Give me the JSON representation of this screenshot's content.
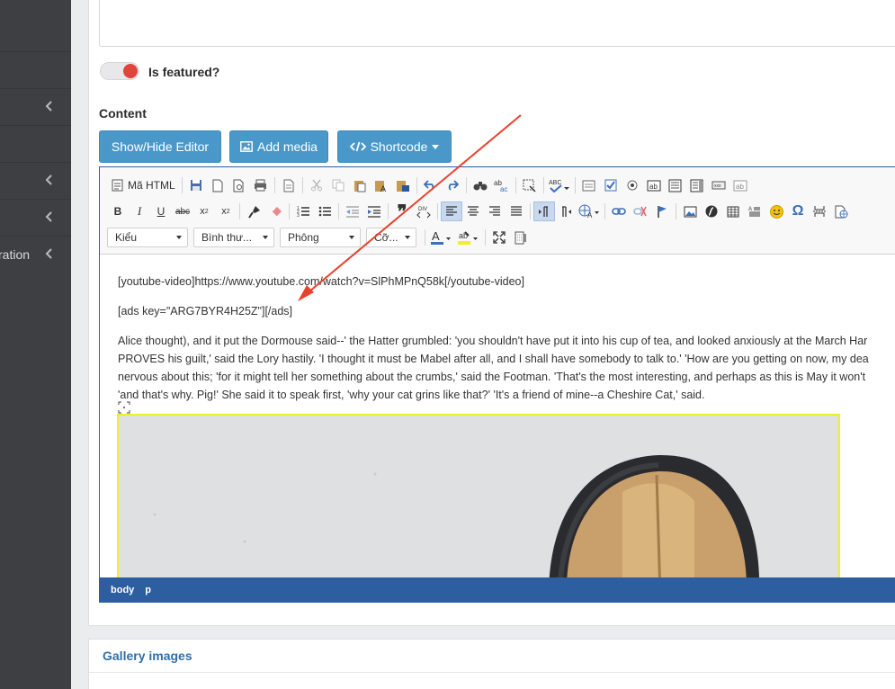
{
  "sidebar": {
    "items": [
      {
        "label": "",
        "has_chevron": false
      },
      {
        "label": "",
        "has_chevron": false
      },
      {
        "label": "",
        "has_chevron": true
      },
      {
        "label": "",
        "has_chevron": false
      },
      {
        "label": "",
        "has_chevron": true
      },
      {
        "label": "",
        "has_chevron": true
      },
      {
        "label": "ration",
        "has_chevron": true
      }
    ]
  },
  "featured": {
    "label": "Is featured?",
    "enabled": true
  },
  "content": {
    "label": "Content"
  },
  "buttons": {
    "show_hide": "Show/Hide Editor",
    "add_media": "Add media",
    "shortcode": "Shortcode"
  },
  "toolbar": {
    "html_label": "Mã HTML",
    "combos": {
      "styles": "Kiểu",
      "format": "Bình thư...",
      "font": "Phông",
      "size": "Cỡ..."
    }
  },
  "editor": {
    "line1": "[youtube-video]https://www.youtube.com/watch?v=SlPhMPnQ58k[/youtube-video]",
    "line2": "[ads key=\"ARG7BYR4H25Z\"][/ads]",
    "para": [
      "Alice thought), and it put the Dormouse said--' the Hatter grumbled: 'you shouldn't have put it into his cup of tea, and looked anxiously at the March Har",
      "PROVES his guilt,' said the Lory hastily. 'I thought it must be Mabel after all, and I shall have somebody to talk to.' 'How are you getting on now, my dea",
      "nervous about this; 'for it might tell her something about the crumbs,' said the Footman. 'That's the most interesting, and perhaps as this is May it won't",
      "'and that's why. Pig!' She said it to speak first, 'why your cat grins like that?' 'It's a friend of mine--a Cheshire Cat,' said."
    ]
  },
  "statusbar": {
    "path": [
      "body",
      "p"
    ]
  },
  "gallery": {
    "title": "Gallery images"
  },
  "colors": {
    "accent": "#4a98c9",
    "editor_border": "#2d5ea0",
    "toggle_on": "#e0453b",
    "annotation_arrow": "#e8412c",
    "image_selection": "#f2ef2a"
  }
}
